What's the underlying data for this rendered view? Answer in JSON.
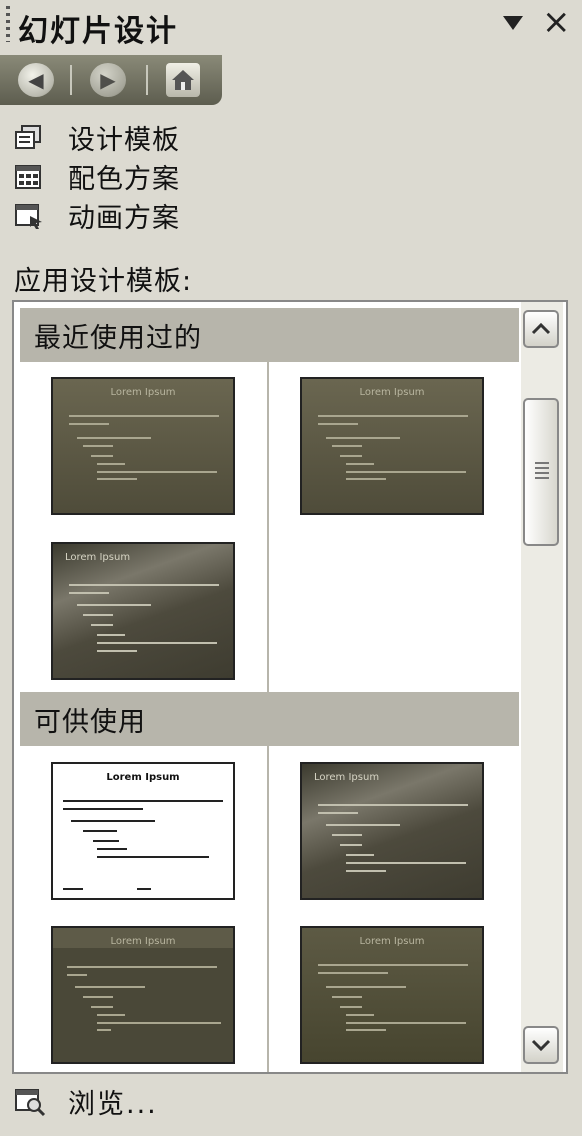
{
  "pane": {
    "title": "幻灯片设计"
  },
  "links": [
    {
      "label": "设计模板",
      "icon": "design-template-icon"
    },
    {
      "label": "配色方案",
      "icon": "color-scheme-icon"
    },
    {
      "label": "动画方案",
      "icon": "animation-scheme-icon"
    }
  ],
  "apply_label": "应用设计模板:",
  "gallery": {
    "recent_header": "最近使用过的",
    "available_header": "可供使用",
    "thumbnail_title": "Lorem Ipsum"
  },
  "browse_label": "浏览..."
}
